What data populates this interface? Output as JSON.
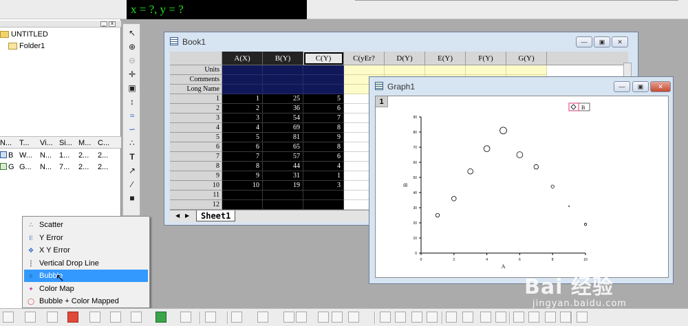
{
  "coord_readout": "x = ?, y = ?",
  "project": {
    "root": "UNTITLED",
    "folder": "Folder1",
    "columns": [
      "N...",
      "T...",
      "Vi...",
      "Si...",
      "M...",
      "C..."
    ],
    "rows": [
      {
        "icon": "workbook-icon",
        "n": "B",
        "t": "W...",
        "vi": "N...",
        "si": "1...",
        "m": "2...",
        "c": "2..."
      },
      {
        "icon": "graph-icon",
        "n": "G",
        "t": "G...",
        "vi": "N...",
        "si": "7...",
        "m": "2...",
        "c": "2..."
      }
    ]
  },
  "book": {
    "title": "Book1",
    "columns": [
      "A(X)",
      "B(Y)",
      "C(Y)",
      "C(yEr?",
      "D(Y)",
      "E(Y)",
      "F(Y)",
      "G(Y)"
    ],
    "meta_labels": [
      "Units",
      "Comments",
      "Long Name"
    ],
    "row_numbers": [
      "1",
      "2",
      "3",
      "4",
      "5",
      "6",
      "7",
      "8",
      "9",
      "10",
      "11",
      "12"
    ],
    "data": [
      [
        "1",
        "25",
        "5"
      ],
      [
        "2",
        "36",
        "6"
      ],
      [
        "3",
        "54",
        "7"
      ],
      [
        "4",
        "69",
        "8"
      ],
      [
        "5",
        "81",
        "9"
      ],
      [
        "6",
        "65",
        "8"
      ],
      [
        "7",
        "57",
        "6"
      ],
      [
        "8",
        "44",
        "4"
      ],
      [
        "9",
        "31",
        "1"
      ],
      [
        "10",
        "19",
        "3"
      ]
    ],
    "sheet_tab": "Sheet1"
  },
  "graph": {
    "title": "Graph1",
    "layer": "1",
    "legend_label": "B",
    "xlabel": "A",
    "ylabel": "B"
  },
  "chart_data": {
    "type": "scatter",
    "subtype": "bubble",
    "x": [
      1,
      2,
      3,
      4,
      5,
      6,
      7,
      8,
      9,
      10
    ],
    "y": [
      25,
      36,
      54,
      69,
      81,
      65,
      57,
      44,
      31,
      19
    ],
    "size": [
      5,
      6,
      7,
      8,
      9,
      8,
      6,
      4,
      1,
      3
    ],
    "xlabel": "A",
    "ylabel": "B",
    "xlim": [
      0,
      10
    ],
    "ylim": [
      0,
      90
    ],
    "xticks": [
      "0",
      "2",
      "4",
      "6",
      "8",
      "10"
    ],
    "yticks": [
      "0",
      "10",
      "20",
      "30",
      "40",
      "50",
      "60",
      "70",
      "80",
      "90"
    ],
    "legend": [
      "B"
    ],
    "legend_position": "top-right",
    "grid": false
  },
  "plot_menu": {
    "items": [
      {
        "label": "Scatter",
        "icon": "scatter-icon"
      },
      {
        "label": "Y Error",
        "icon": "y-error-icon"
      },
      {
        "label": "X Y Error",
        "icon": "xy-error-icon"
      },
      {
        "label": "Vertical Drop Line",
        "icon": "drop-line-icon"
      },
      {
        "label": "Bubble",
        "icon": "bubble-icon"
      },
      {
        "label": "Color Map",
        "icon": "color-map-icon"
      },
      {
        "label": "Bubble + Color Mapped",
        "icon": "bubble-color-mapped-icon"
      }
    ],
    "highlighted": "Bubble"
  },
  "watermark": {
    "logo_text": "Bai 经验",
    "url": "jingyan.baidu.com"
  }
}
